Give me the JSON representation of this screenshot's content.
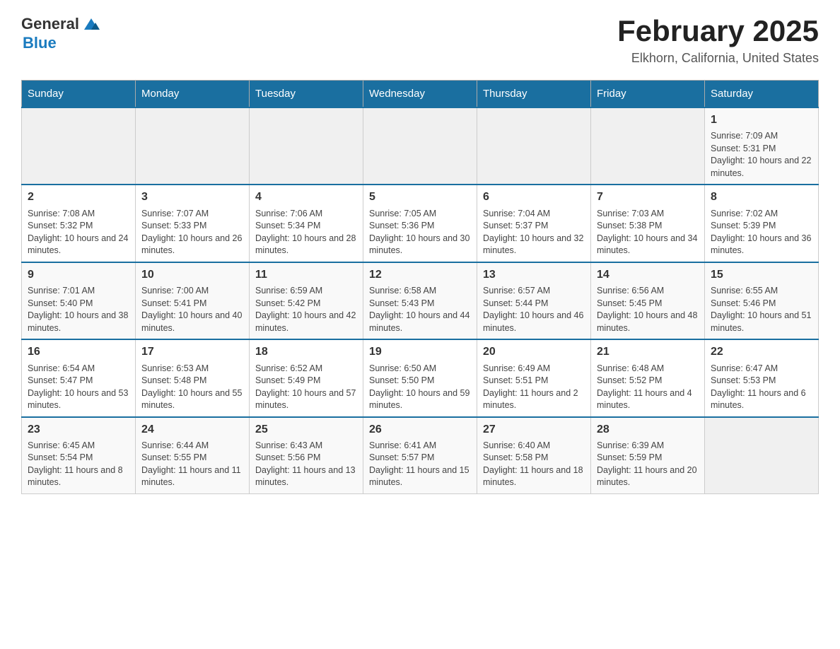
{
  "header": {
    "logo_general": "General",
    "logo_blue": "Blue",
    "title": "February 2025",
    "subtitle": "Elkhorn, California, United States"
  },
  "days_of_week": [
    "Sunday",
    "Monday",
    "Tuesday",
    "Wednesday",
    "Thursday",
    "Friday",
    "Saturday"
  ],
  "weeks": [
    [
      {
        "day": "",
        "info": ""
      },
      {
        "day": "",
        "info": ""
      },
      {
        "day": "",
        "info": ""
      },
      {
        "day": "",
        "info": ""
      },
      {
        "day": "",
        "info": ""
      },
      {
        "day": "",
        "info": ""
      },
      {
        "day": "1",
        "info": "Sunrise: 7:09 AM\nSunset: 5:31 PM\nDaylight: 10 hours and 22 minutes."
      }
    ],
    [
      {
        "day": "2",
        "info": "Sunrise: 7:08 AM\nSunset: 5:32 PM\nDaylight: 10 hours and 24 minutes."
      },
      {
        "day": "3",
        "info": "Sunrise: 7:07 AM\nSunset: 5:33 PM\nDaylight: 10 hours and 26 minutes."
      },
      {
        "day": "4",
        "info": "Sunrise: 7:06 AM\nSunset: 5:34 PM\nDaylight: 10 hours and 28 minutes."
      },
      {
        "day": "5",
        "info": "Sunrise: 7:05 AM\nSunset: 5:36 PM\nDaylight: 10 hours and 30 minutes."
      },
      {
        "day": "6",
        "info": "Sunrise: 7:04 AM\nSunset: 5:37 PM\nDaylight: 10 hours and 32 minutes."
      },
      {
        "day": "7",
        "info": "Sunrise: 7:03 AM\nSunset: 5:38 PM\nDaylight: 10 hours and 34 minutes."
      },
      {
        "day": "8",
        "info": "Sunrise: 7:02 AM\nSunset: 5:39 PM\nDaylight: 10 hours and 36 minutes."
      }
    ],
    [
      {
        "day": "9",
        "info": "Sunrise: 7:01 AM\nSunset: 5:40 PM\nDaylight: 10 hours and 38 minutes."
      },
      {
        "day": "10",
        "info": "Sunrise: 7:00 AM\nSunset: 5:41 PM\nDaylight: 10 hours and 40 minutes."
      },
      {
        "day": "11",
        "info": "Sunrise: 6:59 AM\nSunset: 5:42 PM\nDaylight: 10 hours and 42 minutes."
      },
      {
        "day": "12",
        "info": "Sunrise: 6:58 AM\nSunset: 5:43 PM\nDaylight: 10 hours and 44 minutes."
      },
      {
        "day": "13",
        "info": "Sunrise: 6:57 AM\nSunset: 5:44 PM\nDaylight: 10 hours and 46 minutes."
      },
      {
        "day": "14",
        "info": "Sunrise: 6:56 AM\nSunset: 5:45 PM\nDaylight: 10 hours and 48 minutes."
      },
      {
        "day": "15",
        "info": "Sunrise: 6:55 AM\nSunset: 5:46 PM\nDaylight: 10 hours and 51 minutes."
      }
    ],
    [
      {
        "day": "16",
        "info": "Sunrise: 6:54 AM\nSunset: 5:47 PM\nDaylight: 10 hours and 53 minutes."
      },
      {
        "day": "17",
        "info": "Sunrise: 6:53 AM\nSunset: 5:48 PM\nDaylight: 10 hours and 55 minutes."
      },
      {
        "day": "18",
        "info": "Sunrise: 6:52 AM\nSunset: 5:49 PM\nDaylight: 10 hours and 57 minutes."
      },
      {
        "day": "19",
        "info": "Sunrise: 6:50 AM\nSunset: 5:50 PM\nDaylight: 10 hours and 59 minutes."
      },
      {
        "day": "20",
        "info": "Sunrise: 6:49 AM\nSunset: 5:51 PM\nDaylight: 11 hours and 2 minutes."
      },
      {
        "day": "21",
        "info": "Sunrise: 6:48 AM\nSunset: 5:52 PM\nDaylight: 11 hours and 4 minutes."
      },
      {
        "day": "22",
        "info": "Sunrise: 6:47 AM\nSunset: 5:53 PM\nDaylight: 11 hours and 6 minutes."
      }
    ],
    [
      {
        "day": "23",
        "info": "Sunrise: 6:45 AM\nSunset: 5:54 PM\nDaylight: 11 hours and 8 minutes."
      },
      {
        "day": "24",
        "info": "Sunrise: 6:44 AM\nSunset: 5:55 PM\nDaylight: 11 hours and 11 minutes."
      },
      {
        "day": "25",
        "info": "Sunrise: 6:43 AM\nSunset: 5:56 PM\nDaylight: 11 hours and 13 minutes."
      },
      {
        "day": "26",
        "info": "Sunrise: 6:41 AM\nSunset: 5:57 PM\nDaylight: 11 hours and 15 minutes."
      },
      {
        "day": "27",
        "info": "Sunrise: 6:40 AM\nSunset: 5:58 PM\nDaylight: 11 hours and 18 minutes."
      },
      {
        "day": "28",
        "info": "Sunrise: 6:39 AM\nSunset: 5:59 PM\nDaylight: 11 hours and 20 minutes."
      },
      {
        "day": "",
        "info": ""
      }
    ]
  ]
}
